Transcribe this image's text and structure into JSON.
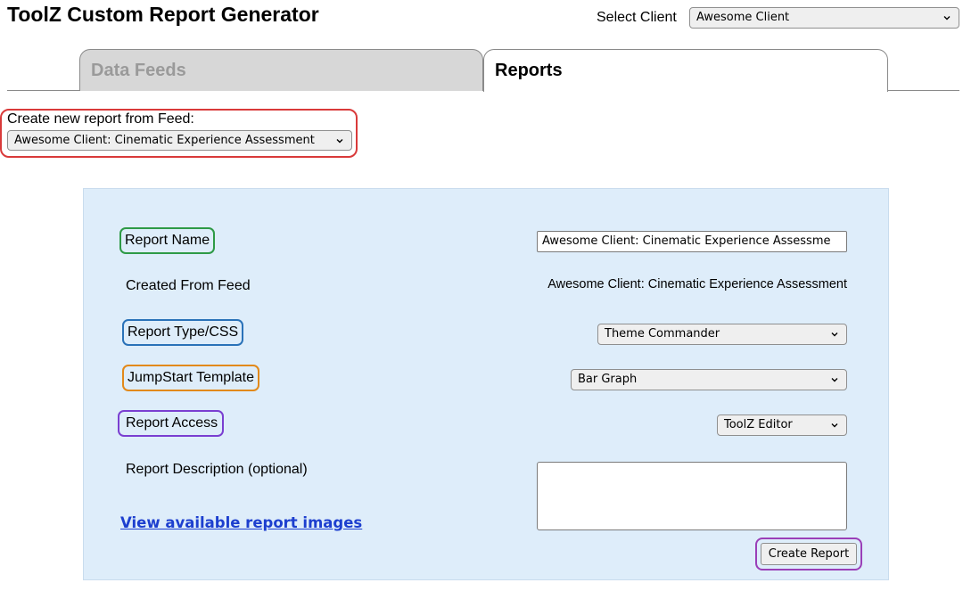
{
  "header": {
    "title": "ToolZ Custom Report Generator",
    "client_label": "Select Client",
    "client_selected": "Awesome Client"
  },
  "tabs": [
    {
      "label": "Data Feeds",
      "active": false
    },
    {
      "label": "Reports",
      "active": true
    }
  ],
  "feed_picker": {
    "label": "Create new report from Feed:",
    "selected": "Awesome Client: Cinematic Experience Assessment"
  },
  "form": {
    "report_name_label": "Report Name",
    "report_name_value": "Awesome Client: Cinematic Experience Assessme",
    "created_from_feed_label": "Created From Feed",
    "created_from_feed_value": "Awesome Client: Cinematic Experience Assessment",
    "report_type_label": "Report Type/CSS",
    "report_type_value": "Theme Commander",
    "jumpstart_label": "JumpStart Template",
    "jumpstart_value": "Bar Graph",
    "access_label": "Report Access",
    "access_value": "ToolZ Editor",
    "description_label": "Report Description (optional)",
    "description_value": "",
    "images_link": "View available report images",
    "create_button": "Create Report"
  },
  "colors": {
    "panel_bg": "#deedfa",
    "link": "#1d3fcf",
    "highlight_red": "#d93a3a",
    "highlight_green": "#2e9a46",
    "highlight_blue": "#2a72b8",
    "highlight_orange": "#e2891a",
    "highlight_violet": "#7a3fd1",
    "highlight_purple": "#9a3fb8"
  },
  "icons": {
    "dropdown": "chevron-down-icon",
    "resize": "resize-grip-icon"
  }
}
